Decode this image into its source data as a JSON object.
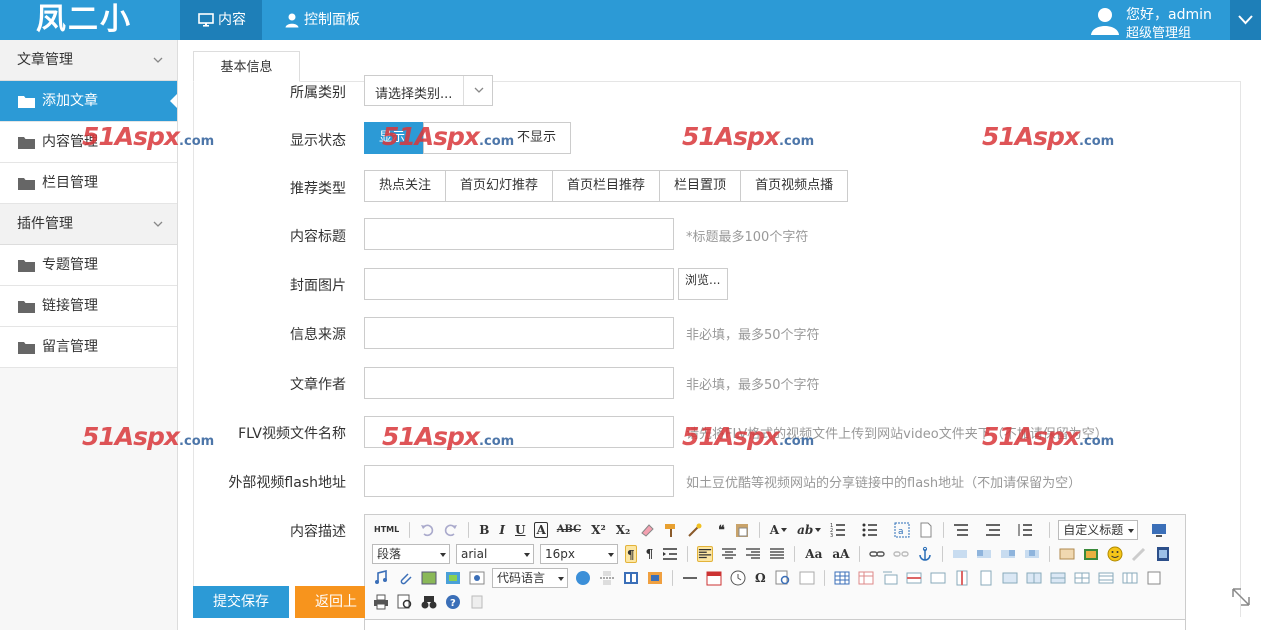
{
  "header": {
    "logo": "凤二小",
    "nav": [
      {
        "label": "内容",
        "icon": "monitor-icon"
      },
      {
        "label": "控制面板",
        "icon": "user-icon"
      }
    ],
    "user": {
      "greeting": "您好，admin",
      "role": "超级管理组"
    }
  },
  "sidebar": {
    "groups": [
      {
        "label": "文章管理",
        "items": [
          "添加文章",
          "内容管理",
          "栏目管理"
        ]
      },
      {
        "label": "插件管理",
        "items": [
          "专题管理",
          "链接管理",
          "留言管理"
        ]
      }
    ],
    "active_item": "添加文章"
  },
  "form": {
    "tab": "基本信息",
    "category": {
      "label": "所属类别",
      "value": "请选择类别..."
    },
    "display": {
      "label": "显示状态",
      "options": [
        "显示",
        "不显示"
      ],
      "selected": "显示"
    },
    "recommend": {
      "label": "推荐类型",
      "options": [
        "热点关注",
        "首页幻灯推荐",
        "首页栏目推荐",
        "栏目置顶",
        "首页视频点播"
      ]
    },
    "title": {
      "label": "内容标题",
      "hint": "*标题最多100个字符"
    },
    "cover": {
      "label": "封面图片",
      "browse": "浏览..."
    },
    "source": {
      "label": "信息来源",
      "hint": "非必填，最多50个字符"
    },
    "author": {
      "label": "文章作者",
      "hint": "非必填，最多50个字符"
    },
    "flv": {
      "label": "FLV视频文件名称",
      "hint": "请先将FLV格式的视频文件上传到网站video文件夹下（不加请保留为空）"
    },
    "flash": {
      "label": "外部视频flash地址",
      "hint": "如土豆优酷等视频网站的分享链接中的flash地址（不加请保留为空）"
    },
    "description": {
      "label": "内容描述"
    }
  },
  "editor": {
    "html_label": "HTML",
    "custom_title": "自定义标题",
    "paragraph": "段落",
    "font": "arial",
    "size": "16px",
    "code_lang": "代码语言"
  },
  "actions": {
    "save": "提交保存",
    "back": "返回上一页"
  },
  "watermark": {
    "brand": "51Aspx",
    "suffix": ".com"
  },
  "colors": {
    "primary": "#2c9ad6",
    "primary_dark": "#1e7fb8",
    "orange": "#f7941d"
  }
}
